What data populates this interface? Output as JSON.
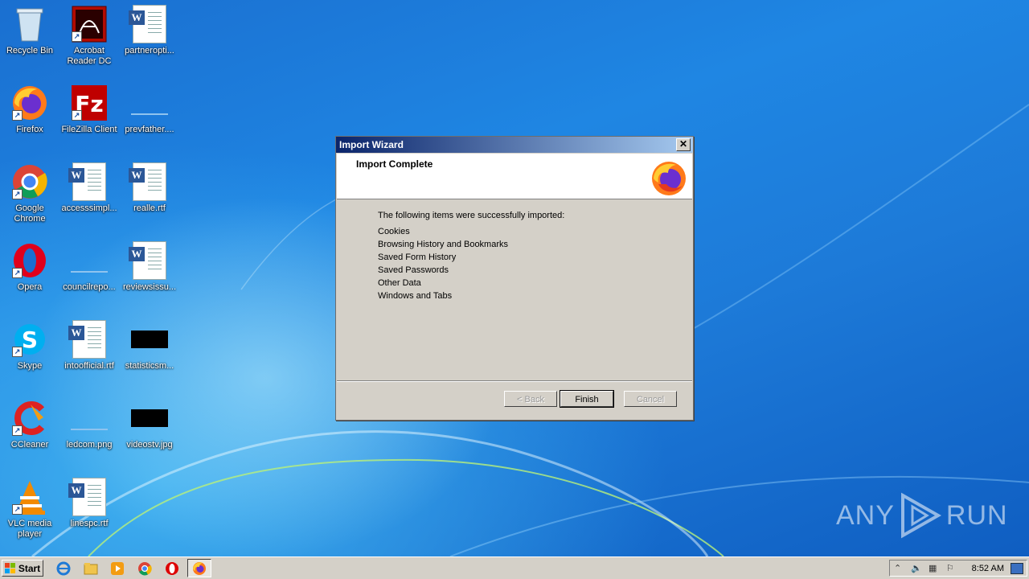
{
  "desktop": {
    "icons": [
      {
        "label": "Recycle Bin",
        "icon": "recycle-bin-icon"
      },
      {
        "label": "Acrobat Reader DC",
        "icon": "acrobat-icon"
      },
      {
        "label": "partneropti...",
        "icon": "word-doc-icon"
      },
      {
        "label": "Firefox",
        "icon": "firefox-icon"
      },
      {
        "label": "FileZilla Client",
        "icon": "filezilla-icon"
      },
      {
        "label": "prevfather....",
        "icon": "file-icon"
      },
      {
        "label": "Google Chrome",
        "icon": "chrome-icon"
      },
      {
        "label": "accesssimpl...",
        "icon": "word-doc-icon"
      },
      {
        "label": "realle.rtf",
        "icon": "word-doc-icon"
      },
      {
        "label": "Opera",
        "icon": "opera-icon"
      },
      {
        "label": "councilrepo...",
        "icon": "file-icon"
      },
      {
        "label": "reviewsissu...",
        "icon": "word-doc-icon"
      },
      {
        "label": "Skype",
        "icon": "skype-icon"
      },
      {
        "label": "intoofficial.rtf",
        "icon": "word-doc-icon"
      },
      {
        "label": "statisticsm...",
        "icon": "image-thumb-icon"
      },
      {
        "label": "CCleaner",
        "icon": "ccleaner-icon"
      },
      {
        "label": "ledcom.png",
        "icon": "image-icon"
      },
      {
        "label": "videostv.jpg",
        "icon": "image-thumb-icon"
      },
      {
        "label": "VLC media player",
        "icon": "vlc-icon"
      },
      {
        "label": "linespc.rtf",
        "icon": "word-doc-icon"
      }
    ]
  },
  "dialog": {
    "title": "Import Wizard",
    "close_label": "✕",
    "heading": "Import Complete",
    "intro": "The following items were successfully imported:",
    "items": [
      "Cookies",
      "Browsing History and Bookmarks",
      "Saved Form History",
      "Saved Passwords",
      "Other Data",
      "Windows and Tabs"
    ],
    "buttons": {
      "back": "< Back",
      "finish": "Finish",
      "cancel": "Cancel"
    }
  },
  "watermark": {
    "left": "ANY",
    "right": "RUN"
  },
  "taskbar": {
    "start_label": "Start",
    "clock": "8:52 AM",
    "pinned": [
      "ie-icon",
      "explorer-icon",
      "media-player-icon",
      "chrome-icon",
      "opera-icon",
      "firefox-icon"
    ]
  }
}
